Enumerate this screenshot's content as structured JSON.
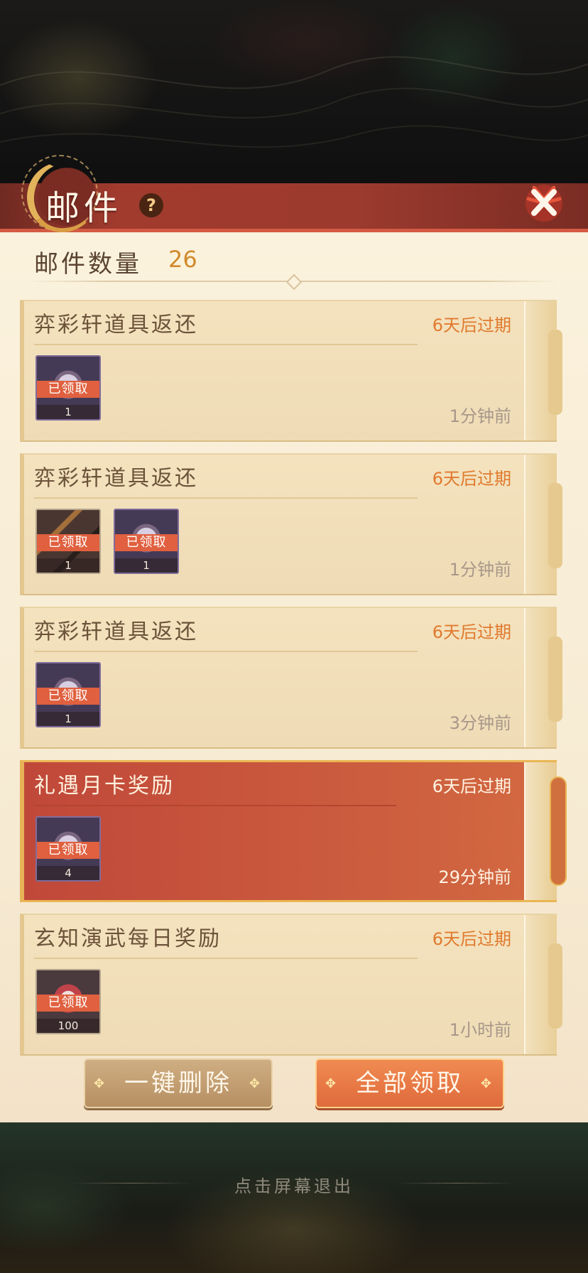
{
  "header": {
    "title": "邮件",
    "help_symbol": "?"
  },
  "summary": {
    "count_label": "邮件数量",
    "count_value": "26"
  },
  "mails": [
    {
      "title": "弈彩轩道具返还",
      "expire": "6天后过期",
      "time": "1分钟前",
      "active": false,
      "items": [
        {
          "badge": "已领取",
          "qty": "1",
          "style": "purple"
        }
      ]
    },
    {
      "title": "弈彩轩道具返还",
      "expire": "6天后过期",
      "time": "1分钟前",
      "active": false,
      "items": [
        {
          "badge": "已领取",
          "qty": "1",
          "style": "bow"
        },
        {
          "badge": "已领取",
          "qty": "1",
          "style": "purple"
        }
      ]
    },
    {
      "title": "弈彩轩道具返还",
      "expire": "6天后过期",
      "time": "3分钟前",
      "active": false,
      "items": [
        {
          "badge": "已领取",
          "qty": "1",
          "style": "purple"
        }
      ]
    },
    {
      "title": "礼遇月卡奖励",
      "expire": "6天后过期",
      "time": "29分钟前",
      "active": true,
      "items": [
        {
          "badge": "已领取",
          "qty": "4",
          "style": "purple"
        }
      ]
    },
    {
      "title": "玄知演武每日奖励",
      "expire": "6天后过期",
      "time": "1小时前",
      "active": false,
      "items": [
        {
          "badge": "已领取",
          "qty": "100",
          "style": "red"
        }
      ]
    }
  ],
  "actions": {
    "delete_all": "一键删除",
    "claim_all": "全部领取",
    "ornament": "✥"
  },
  "footer": {
    "exit_hint": "点击屏幕退出"
  },
  "colors": {
    "accent": "#e07a2e",
    "ribbon": "#9c3a2e",
    "badge": "#e0603f"
  }
}
